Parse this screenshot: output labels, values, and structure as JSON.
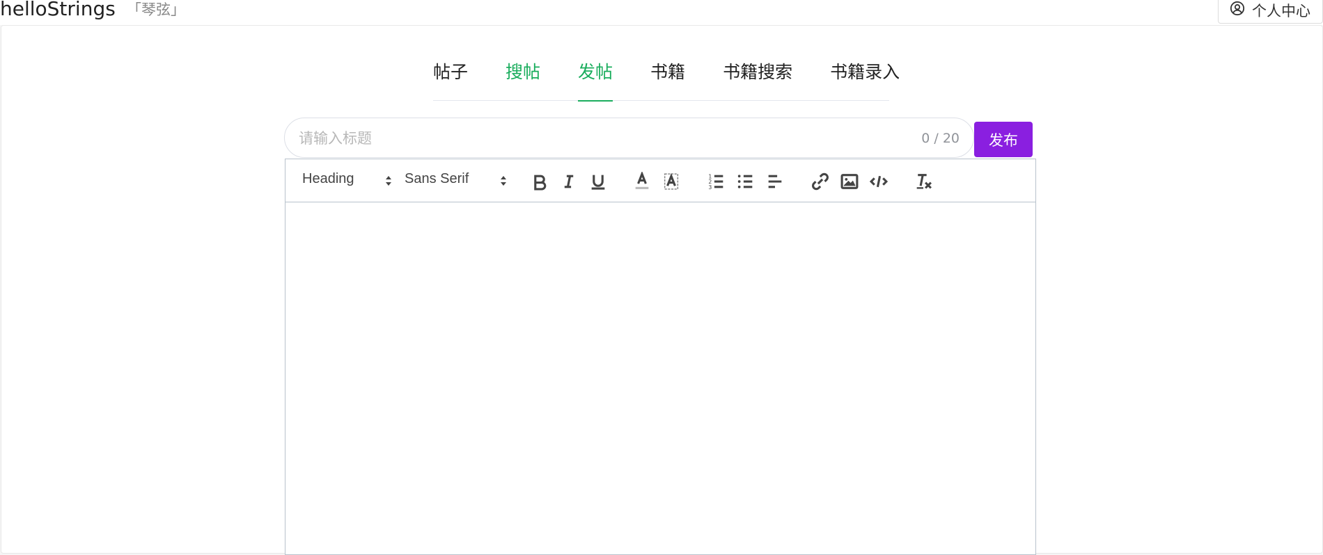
{
  "header": {
    "brand": "helloStrings",
    "subtitle": "「琴弦」",
    "user_center_label": "个人中心",
    "user_icon": "user-circle-icon"
  },
  "tabs": [
    {
      "label": "帖子",
      "state": "normal"
    },
    {
      "label": "搜帖",
      "state": "highlight"
    },
    {
      "label": "发帖",
      "state": "active"
    },
    {
      "label": "书籍",
      "state": "normal"
    },
    {
      "label": "书籍搜索",
      "state": "normal"
    },
    {
      "label": "书籍录入",
      "state": "normal"
    }
  ],
  "post_form": {
    "title_placeholder": "请输入标题",
    "title_value": "",
    "counter": "0 / 20",
    "publish_label": "发布"
  },
  "toolbar": {
    "heading_select": "Heading",
    "font_select": "Sans Serif",
    "icons": [
      "bold-icon",
      "italic-icon",
      "underline-icon",
      "text-color-icon",
      "background-color-icon",
      "ordered-list-icon",
      "bullet-list-icon",
      "align-icon",
      "link-icon",
      "image-icon",
      "code-block-icon",
      "clear-format-icon"
    ]
  },
  "colors": {
    "active_tab": "#1aad5d",
    "publish_button": "#8a1fe0",
    "editor_border": "#b8c2cc"
  }
}
